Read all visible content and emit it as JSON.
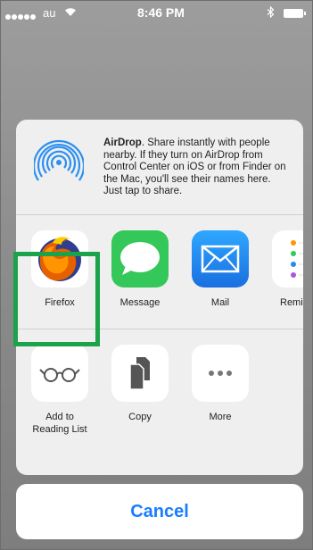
{
  "status_bar": {
    "carrier": "au",
    "time": "8:46 PM"
  },
  "airdrop": {
    "title": "AirDrop",
    "description": ". Share instantly with people nearby. If they turn on AirDrop from Control Center on iOS or from Finder on the Mac, you'll see their names here. Just tap to share."
  },
  "apps": [
    {
      "label": "Firefox",
      "icon": "firefox-icon"
    },
    {
      "label": "Message",
      "icon": "message-icon"
    },
    {
      "label": "Mail",
      "icon": "mail-icon"
    },
    {
      "label": "Remi",
      "icon": "reminders-icon"
    }
  ],
  "actions": [
    {
      "label": "Add to\nReading List",
      "icon": "glasses-icon"
    },
    {
      "label": "Copy",
      "icon": "copy-icon"
    },
    {
      "label": "More",
      "icon": "more-icon"
    }
  ],
  "cancel_label": "Cancel",
  "colors": {
    "accent_blue": "#1a7dff",
    "highlight_green": "#1aa34a",
    "messages_green": "#34c759",
    "mail_blue": "#1f8ef1"
  }
}
